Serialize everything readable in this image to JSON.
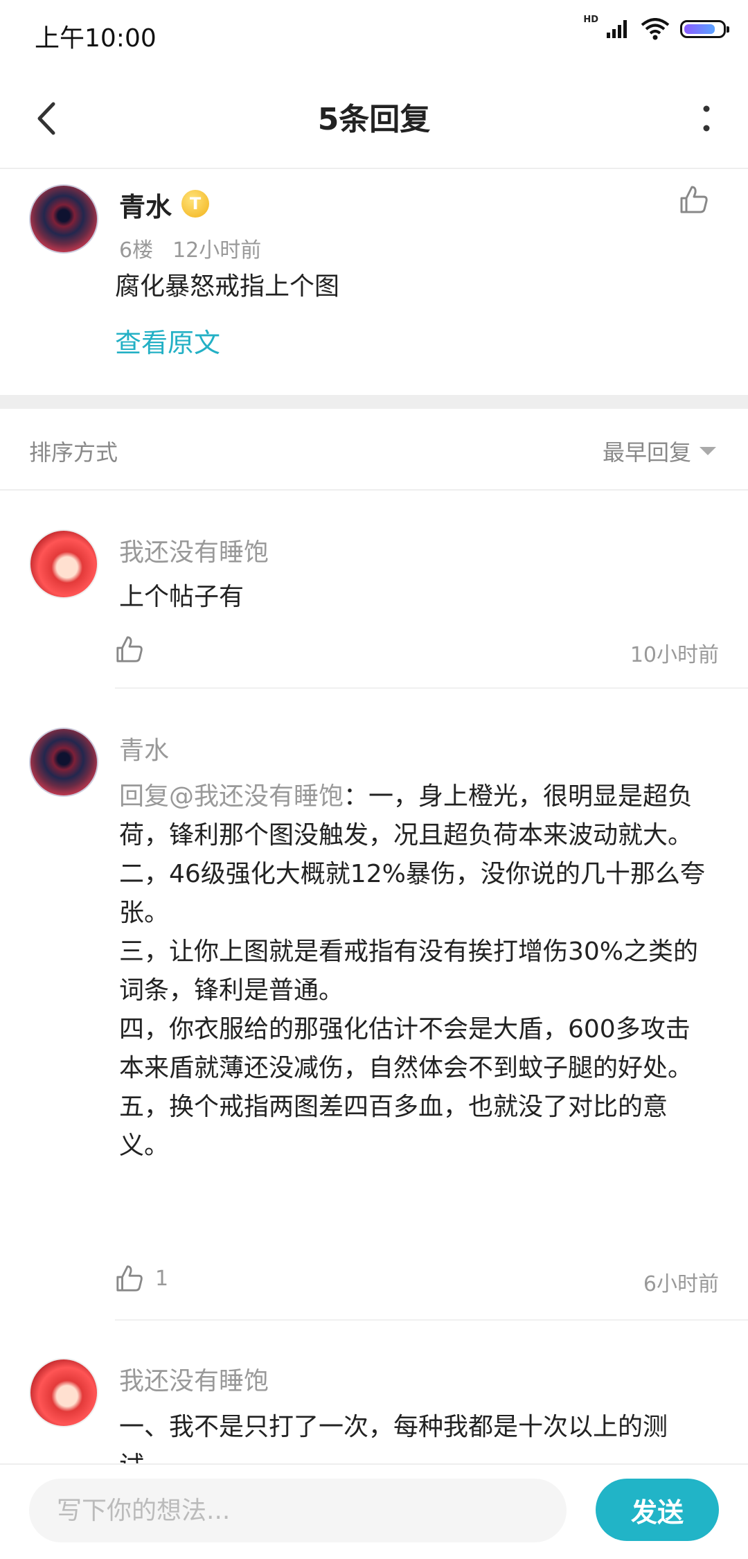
{
  "status_bar": {
    "time": "上午10:00",
    "network_label": "HD"
  },
  "header": {
    "title": "5条回复"
  },
  "main_post": {
    "author": "青水",
    "badge": "T",
    "floor": "6楼",
    "time": "12小时前",
    "text": "腐化暴怒戒指上个图",
    "view_original": "查看原文"
  },
  "sort": {
    "label": "排序方式",
    "value": "最早回复"
  },
  "replies": [
    {
      "author": "我还没有睡饱",
      "text": "上个帖子有",
      "likes": "",
      "time": "10小时前"
    },
    {
      "author": "青水",
      "mention": "回复@我还没有睡饱",
      "lines": [
        "：一，身上橙光，很明显是超负荷，锋利那个图没触发，况且超负荷本来波动就大。",
        "二，46级强化大概就12%暴伤，没你说的几十那么夸张。",
        "三，让你上图就是看戒指有没有挨打增伤30%之类的词条，锋利是普通。",
        "四，你衣服给的那强化估计不会是大盾，600多攻击本来盾就薄还没减伤，自然体会不到蚊子腿的好处。",
        "五，换个戒指两图差四百多血，也就没了对比的意义。"
      ],
      "likes": "1",
      "time": "6小时前"
    },
    {
      "author": "我还没有睡饱",
      "text": "一、我不是只打了一次，每种我都是十次以上的测试。"
    }
  ],
  "composer": {
    "placeholder": "写下你的想法...",
    "send_label": "发送"
  },
  "colors": {
    "accent": "#21b4c7",
    "link": "#23b0c5"
  }
}
